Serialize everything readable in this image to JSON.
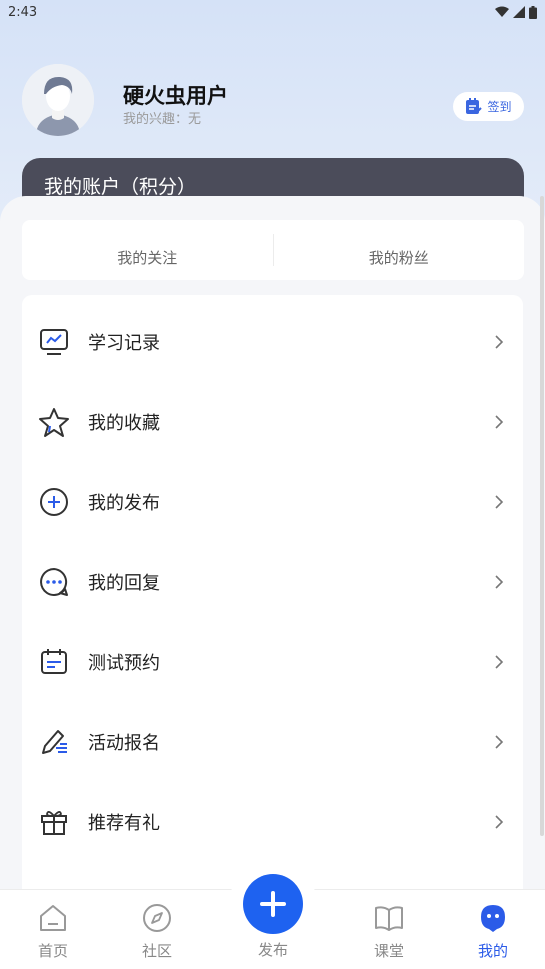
{
  "status_bar": {
    "time": "2:43"
  },
  "profile": {
    "username": "硬火虫用户",
    "interest": "我的兴趣：无",
    "checkin_label": "签到"
  },
  "account": {
    "title": "我的账户（积分）"
  },
  "follow": {
    "following": "我的关注",
    "fans": "我的粉丝"
  },
  "menu": [
    {
      "label": "学习记录",
      "icon": "monitor-chart-icon"
    },
    {
      "label": "我的收藏",
      "icon": "star-icon"
    },
    {
      "label": "我的发布",
      "icon": "plus-circle-icon"
    },
    {
      "label": "我的回复",
      "icon": "chat-bubble-icon"
    },
    {
      "label": "测试预约",
      "icon": "calendar-icon"
    },
    {
      "label": "活动报名",
      "icon": "pen-signup-icon"
    },
    {
      "label": "推荐有礼",
      "icon": "gift-icon"
    }
  ],
  "tabbar": {
    "home": "首页",
    "community": "社区",
    "publish": "发布",
    "classroom": "课堂",
    "mine": "我的"
  },
  "colors": {
    "accent": "#2b5be8",
    "publish": "#1e62f0",
    "card_dark": "#4b4c5a"
  }
}
